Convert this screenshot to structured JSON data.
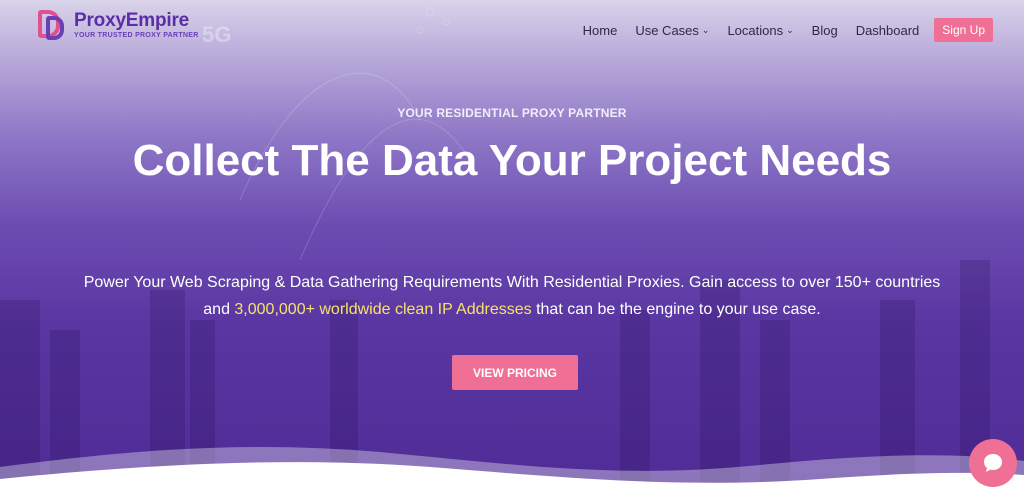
{
  "nav": {
    "brand_name": "ProxyEmpire",
    "brand_tagline": "YOUR TRUSTED PROXY PARTNER",
    "ghost_text": "5G",
    "items": [
      {
        "label": "Home",
        "dropdown": false
      },
      {
        "label": "Use Cases",
        "dropdown": true
      },
      {
        "label": "Locations",
        "dropdown": true
      },
      {
        "label": "Blog",
        "dropdown": false
      },
      {
        "label": "Dashboard",
        "dropdown": false
      }
    ],
    "signup_label": "Sign Up"
  },
  "hero": {
    "eyebrow": "YOUR RESIDENTIAL PROXY PARTNER",
    "headline": "Collect The Data Your Project Needs",
    "desc_part1": "Power Your Web Scraping & Data Gathering Requirements With Residential Proxies. Gain access to over 150+ countries and ",
    "desc_highlight": "3,000,000+ worldwide clean IP Addresses",
    "desc_part2": " that can be the engine to your use case.",
    "cta_label": "VIEW PRICING"
  },
  "colors": {
    "accent_pink": "#ef6f95",
    "brand_purple": "#5b2ea6",
    "highlight_yellow": "#f6e36b"
  },
  "icons": {
    "chat": "chat-bubble-icon",
    "chevron": "chevron-down-icon"
  }
}
